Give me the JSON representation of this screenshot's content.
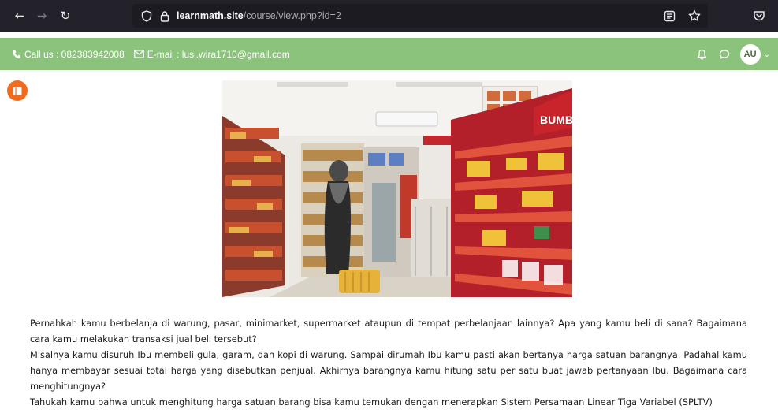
{
  "browser": {
    "url_host": "learnmath.site",
    "url_path": "/course/view.php?id=2"
  },
  "header": {
    "phone_text": "Call us : 082383942008",
    "email_text": "E-mail : lusi.wira1710@gmail.com",
    "avatar_initials": "AU"
  },
  "main": {
    "image_alt": "Minimarket aisle with a shopper browsing shelves",
    "paragraphs": [
      "Pernahkah kamu berbelanja di warung, pasar, minimarket, supermarket ataupun di tempat perbelanjaan lainnya? Apa yang kamu beli di sana? Bagaimana cara kamu melakukan transaksi jual beli tersebut?",
      "Misalnya kamu disuruh Ibu membeli gula, garam, dan kopi di warung. Sampai dirumah Ibu kamu pasti akan bertanya harga satuan barangnya. Padahal kamu hanya membayar sesuai total harga yang disebutkan penjual. Akhirnya barangnya kamu hitung satu per satu buat jawab pertanyaan Ibu. Bagaimana cara menghitungnya?",
      "Tahukah kamu bahwa untuk menghitung harga satuan barang bisa kamu temukan dengan menerapkan Sistem Persamaan Linear Tiga Variabel (SPLTV)"
    ]
  },
  "colors": {
    "header_green": "#8cc37c",
    "drawer_orange": "#f26b1d",
    "chrome_dark": "#23222b"
  },
  "icons": [
    "back-arrow-icon",
    "forward-arrow-icon",
    "reload-icon",
    "shield-icon",
    "lock-icon",
    "reader-view-icon",
    "bookmark-star-icon",
    "pocket-icon",
    "phone-icon",
    "mail-icon",
    "bell-icon",
    "chat-icon",
    "drawer-icon"
  ]
}
